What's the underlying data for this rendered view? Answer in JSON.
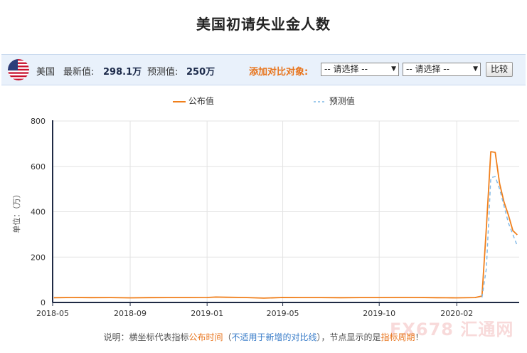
{
  "title": "美国初请失业金人数",
  "info": {
    "country": "美国",
    "latest_label": "最新值:",
    "latest_value": "298.1万",
    "forecast_label": "预测值:",
    "forecast_value": "250万",
    "compare_label": "添加对比对象:",
    "select1": "-- 请选择 --",
    "select2": "-- 请选择 --",
    "compare_button": "比较"
  },
  "footnote": {
    "prefix": "说明：横坐标代表指标",
    "release_time": "公布时间",
    "paren_open": "（",
    "not_applicable": "不适用于新增的对比线",
    "paren_close": "）",
    "middle": "，节点显示的是",
    "period": "指标周期",
    "suffix": "！"
  },
  "watermark": "FX678 汇通网",
  "colors": {
    "actual": "#f07f1b",
    "forecast": "#7fb8e6",
    "accent": "#e8741c"
  },
  "chart_data": {
    "type": "line",
    "title": "美国初请失业金人数",
    "ylabel": "单位：（万）",
    "ylim": [
      0,
      800
    ],
    "yticks": [
      0,
      200,
      400,
      600,
      800
    ],
    "xticks": [
      "2018-05",
      "2018-09",
      "2019-01",
      "2019-05",
      "2019-10",
      "2020-02"
    ],
    "grid": true,
    "legend_position": "top-center",
    "series": [
      {
        "name": "公布值",
        "style": "solid",
        "color": "#f07f1b",
        "points": [
          [
            "2018-05-03",
            21.1
          ],
          [
            "2018-06-01",
            22.1
          ],
          [
            "2018-07-01",
            21.4
          ],
          [
            "2018-08-01",
            21.5
          ],
          [
            "2018-09-01",
            20.3
          ],
          [
            "2018-10-01",
            21.2
          ],
          [
            "2018-11-01",
            21.6
          ],
          [
            "2018-12-01",
            21.8
          ],
          [
            "2019-01-01",
            22.0
          ],
          [
            "2019-01-15",
            24.0
          ],
          [
            "2019-02-01",
            23.0
          ],
          [
            "2019-03-01",
            22.1
          ],
          [
            "2019-04-01",
            19.2
          ],
          [
            "2019-05-01",
            22.0
          ],
          [
            "2019-06-01",
            21.8
          ],
          [
            "2019-07-01",
            21.6
          ],
          [
            "2019-08-01",
            21.0
          ],
          [
            "2019-09-01",
            21.5
          ],
          [
            "2019-10-01",
            21.8
          ],
          [
            "2019-11-01",
            22.3
          ],
          [
            "2019-12-01",
            22.0
          ],
          [
            "2020-01-01",
            21.0
          ],
          [
            "2020-01-15",
            20.8
          ],
          [
            "2020-02-01",
            20.5
          ],
          [
            "2020-03-01",
            21.6
          ],
          [
            "2020-03-12",
            28.1
          ],
          [
            "2020-03-19",
            330.7
          ],
          [
            "2020-03-26",
            664.8
          ],
          [
            "2020-04-02",
            661.5
          ],
          [
            "2020-04-09",
            523.7
          ],
          [
            "2020-04-16",
            442.7
          ],
          [
            "2020-04-23",
            384.6
          ],
          [
            "2020-04-30",
            316.9
          ],
          [
            "2020-05-07",
            298.1
          ]
        ]
      },
      {
        "name": "预测值",
        "style": "dashed",
        "color": "#7fb8e6",
        "points": [
          [
            "2020-03-12",
            22.0
          ],
          [
            "2020-03-19",
            150.0
          ],
          [
            "2020-03-26",
            550.0
          ],
          [
            "2020-04-02",
            555.0
          ],
          [
            "2020-04-09",
            500.0
          ],
          [
            "2020-04-16",
            425.0
          ],
          [
            "2020-04-23",
            350.0
          ],
          [
            "2020-04-30",
            300.0
          ],
          [
            "2020-05-07",
            250.0
          ]
        ]
      }
    ]
  }
}
